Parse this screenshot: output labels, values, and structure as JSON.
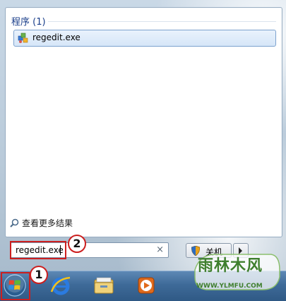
{
  "start_menu": {
    "programs_header": "程序 (1)",
    "results": [
      {
        "label": "regedit.exe",
        "icon": "regedit-icon"
      }
    ],
    "see_more_results": "查看更多结果",
    "search": {
      "value": "regedit.exe",
      "clear_symbol": "×"
    },
    "shutdown": {
      "label": "关机",
      "arrow_icon": "triangle-right-icon"
    }
  },
  "callouts": {
    "one": "1",
    "two": "2"
  },
  "taskbar": {
    "icons": [
      "windows-start-orb",
      "internet-explorer-icon",
      "windows-explorer-icon",
      "windows-media-player-icon"
    ]
  },
  "watermark": {
    "title": "雨林木风",
    "url": "WWW.YLMFU.COM"
  },
  "colors": {
    "highlight_red": "#cc1f1f",
    "selection_blue": "#d6e6f8",
    "header_blue": "#1a3e8a"
  }
}
